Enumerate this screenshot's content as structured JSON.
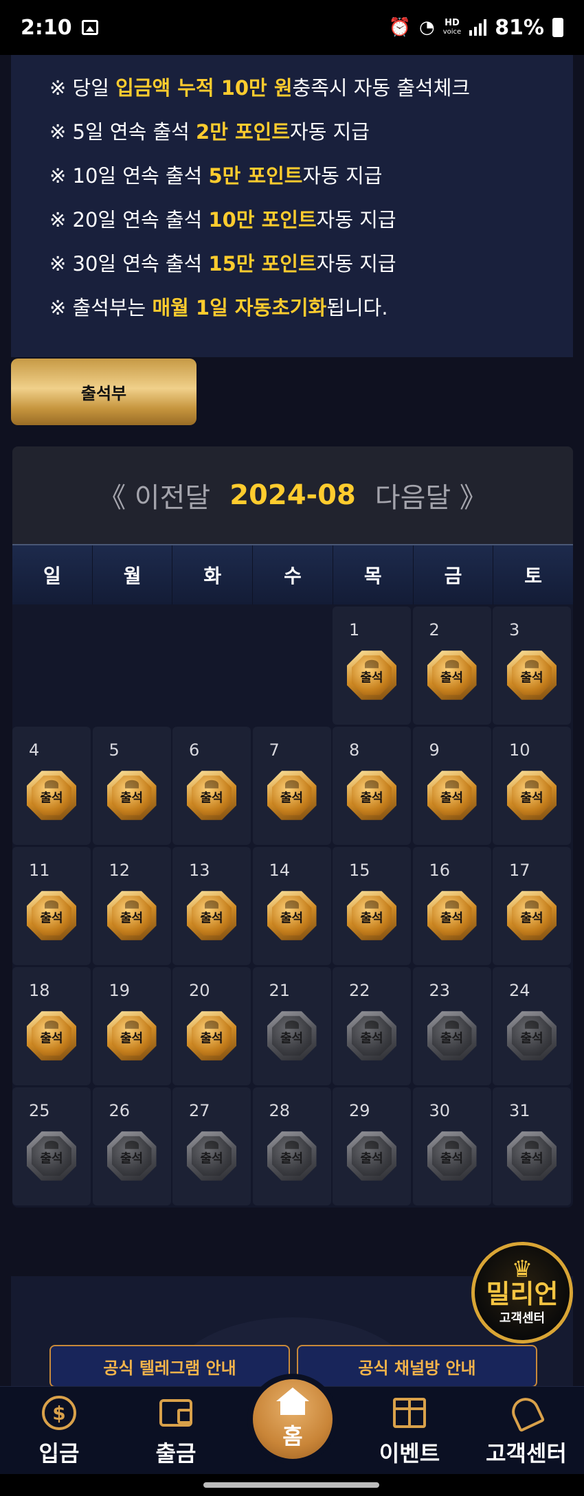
{
  "status_bar": {
    "time": "2:10",
    "battery": "81%",
    "hd_label_top": "HD",
    "hd_label_bottom": "voice"
  },
  "notice": {
    "lines": [
      {
        "prefix": "※ 당일 ",
        "highlight": "입금액 누적 10만 원",
        "suffix": "충족시 자동 출석체크"
      },
      {
        "prefix": "※ 5일 연속 출석 ",
        "highlight": "2만 포인트",
        "suffix": "자동 지급"
      },
      {
        "prefix": "※ 10일 연속 출석 ",
        "highlight": "5만 포인트",
        "suffix": "자동 지급"
      },
      {
        "prefix": "※ 20일 연속 출석 ",
        "highlight": "10만 포인트",
        "suffix": "자동 지급"
      },
      {
        "prefix": "※ 30일 연속 출석 ",
        "highlight": "15만 포인트",
        "suffix": "자동 지급"
      },
      {
        "prefix": "※ 출석부는 ",
        "highlight": "매월 1일 자동초기화",
        "suffix": "됩니다."
      }
    ]
  },
  "attendance_button": {
    "label": "출석부"
  },
  "calendar": {
    "prev_label": "《 이전달",
    "month": "2024-08",
    "next_label": "다음달 》",
    "weekdays": [
      "일",
      "월",
      "화",
      "수",
      "목",
      "금",
      "토"
    ],
    "leading_empty": 4,
    "badge_label": "출석",
    "days": [
      {
        "day": "1",
        "attended": true
      },
      {
        "day": "2",
        "attended": true
      },
      {
        "day": "3",
        "attended": true
      },
      {
        "day": "4",
        "attended": true
      },
      {
        "day": "5",
        "attended": true
      },
      {
        "day": "6",
        "attended": true
      },
      {
        "day": "7",
        "attended": true
      },
      {
        "day": "8",
        "attended": true
      },
      {
        "day": "9",
        "attended": true
      },
      {
        "day": "10",
        "attended": true
      },
      {
        "day": "11",
        "attended": true
      },
      {
        "day": "12",
        "attended": true
      },
      {
        "day": "13",
        "attended": true
      },
      {
        "day": "14",
        "attended": true
      },
      {
        "day": "15",
        "attended": true
      },
      {
        "day": "16",
        "attended": true
      },
      {
        "day": "17",
        "attended": true
      },
      {
        "day": "18",
        "attended": true
      },
      {
        "day": "19",
        "attended": true
      },
      {
        "day": "20",
        "attended": true
      },
      {
        "day": "21",
        "attended": false
      },
      {
        "day": "22",
        "attended": false
      },
      {
        "day": "23",
        "attended": false
      },
      {
        "day": "24",
        "attended": false
      },
      {
        "day": "25",
        "attended": false
      },
      {
        "day": "26",
        "attended": false
      },
      {
        "day": "27",
        "attended": false
      },
      {
        "day": "28",
        "attended": false
      },
      {
        "day": "29",
        "attended": false
      },
      {
        "day": "30",
        "attended": false
      },
      {
        "day": "31",
        "attended": false
      }
    ]
  },
  "info_buttons": {
    "telegram": "공식 텔레그램 안내",
    "channel": "공식 채널방 안내"
  },
  "cs_float": {
    "name": "밀리언",
    "sub": "고객센터"
  },
  "bottom_nav": {
    "deposit": "입금",
    "withdraw": "출금",
    "home": "홈",
    "event": "이벤트",
    "support": "고객센터"
  },
  "colors": {
    "highlight": "#ffcc2e",
    "accent_gold": "#d9a14a",
    "background": "#0f1120"
  }
}
